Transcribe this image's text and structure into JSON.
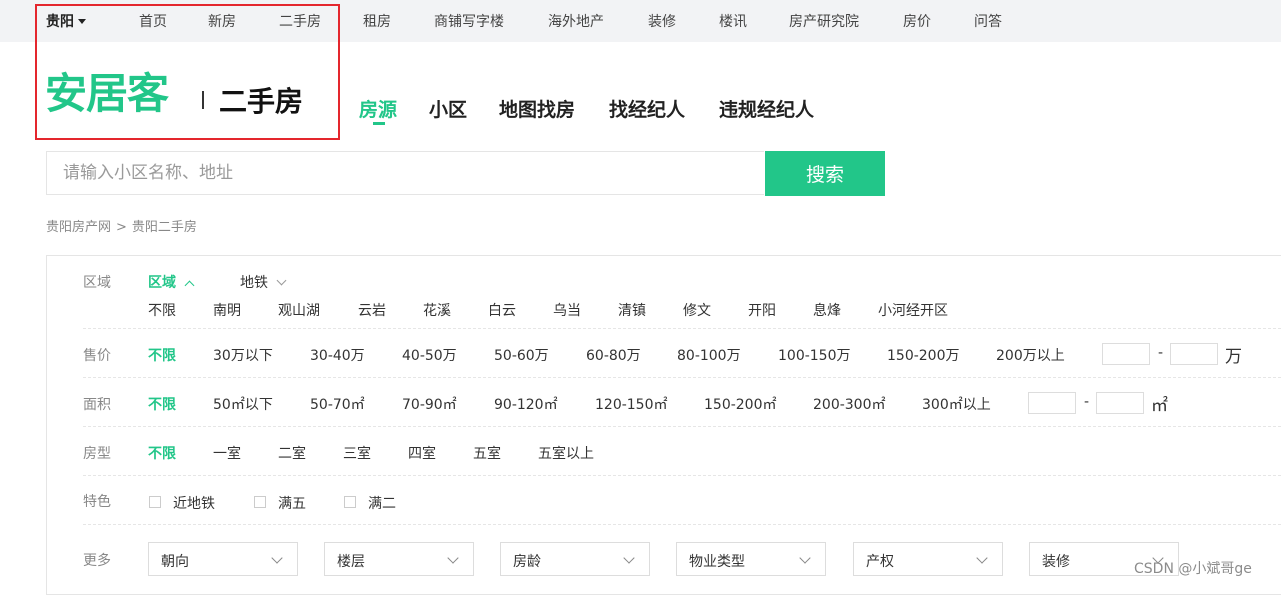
{
  "topbar": {
    "city": "贵阳",
    "nav": [
      "首页",
      "新房",
      "二手房",
      "租房",
      "商铺写字楼",
      "海外地产",
      "装修",
      "楼讯",
      "房产研究院",
      "房价",
      "问答"
    ]
  },
  "brand": {
    "logo": "安居客",
    "section": "二手房",
    "accent_color": "#22c689",
    "highlight_color": "#e4262d"
  },
  "main_tabs": [
    "房源",
    "小区",
    "地图找房",
    "找经纪人",
    "违规经纪人"
  ],
  "search": {
    "placeholder": "请输入小区名称、地址",
    "button_label": "搜索"
  },
  "breadcrumb": {
    "items": [
      "贵阳房产网",
      "贵阳二手房"
    ],
    "separator": ">"
  },
  "filters": {
    "region": {
      "label": "区域",
      "tab_region": "区域",
      "tab_subway": "地铁",
      "options": [
        "不限",
        "南明",
        "观山湖",
        "云岩",
        "花溪",
        "白云",
        "乌当",
        "清镇",
        "修文",
        "开阳",
        "息烽",
        "小河经开区"
      ]
    },
    "price": {
      "label": "售价",
      "options": [
        "不限",
        "30万以下",
        "30-40万",
        "40-50万",
        "50-60万",
        "60-80万",
        "80-100万",
        "100-150万",
        "150-200万",
        "200万以上"
      ],
      "range_dash": "-",
      "unit": "万"
    },
    "area": {
      "label": "面积",
      "options": [
        "不限",
        "50㎡以下",
        "50-70㎡",
        "70-90㎡",
        "90-120㎡",
        "120-150㎡",
        "150-200㎡",
        "200-300㎡",
        "300㎡以上"
      ],
      "range_dash": "-",
      "unit": "㎡"
    },
    "rooms": {
      "label": "房型",
      "options": [
        "不限",
        "一室",
        "二室",
        "三室",
        "四室",
        "五室",
        "五室以上"
      ]
    },
    "features": {
      "label": "特色",
      "options": [
        "近地铁",
        "满五",
        "满二"
      ]
    },
    "more": {
      "label": "更多",
      "selects": [
        "朝向",
        "楼层",
        "房龄",
        "物业类型",
        "产权",
        "装修"
      ]
    }
  },
  "watermark": "CSDN @小斌哥ge"
}
